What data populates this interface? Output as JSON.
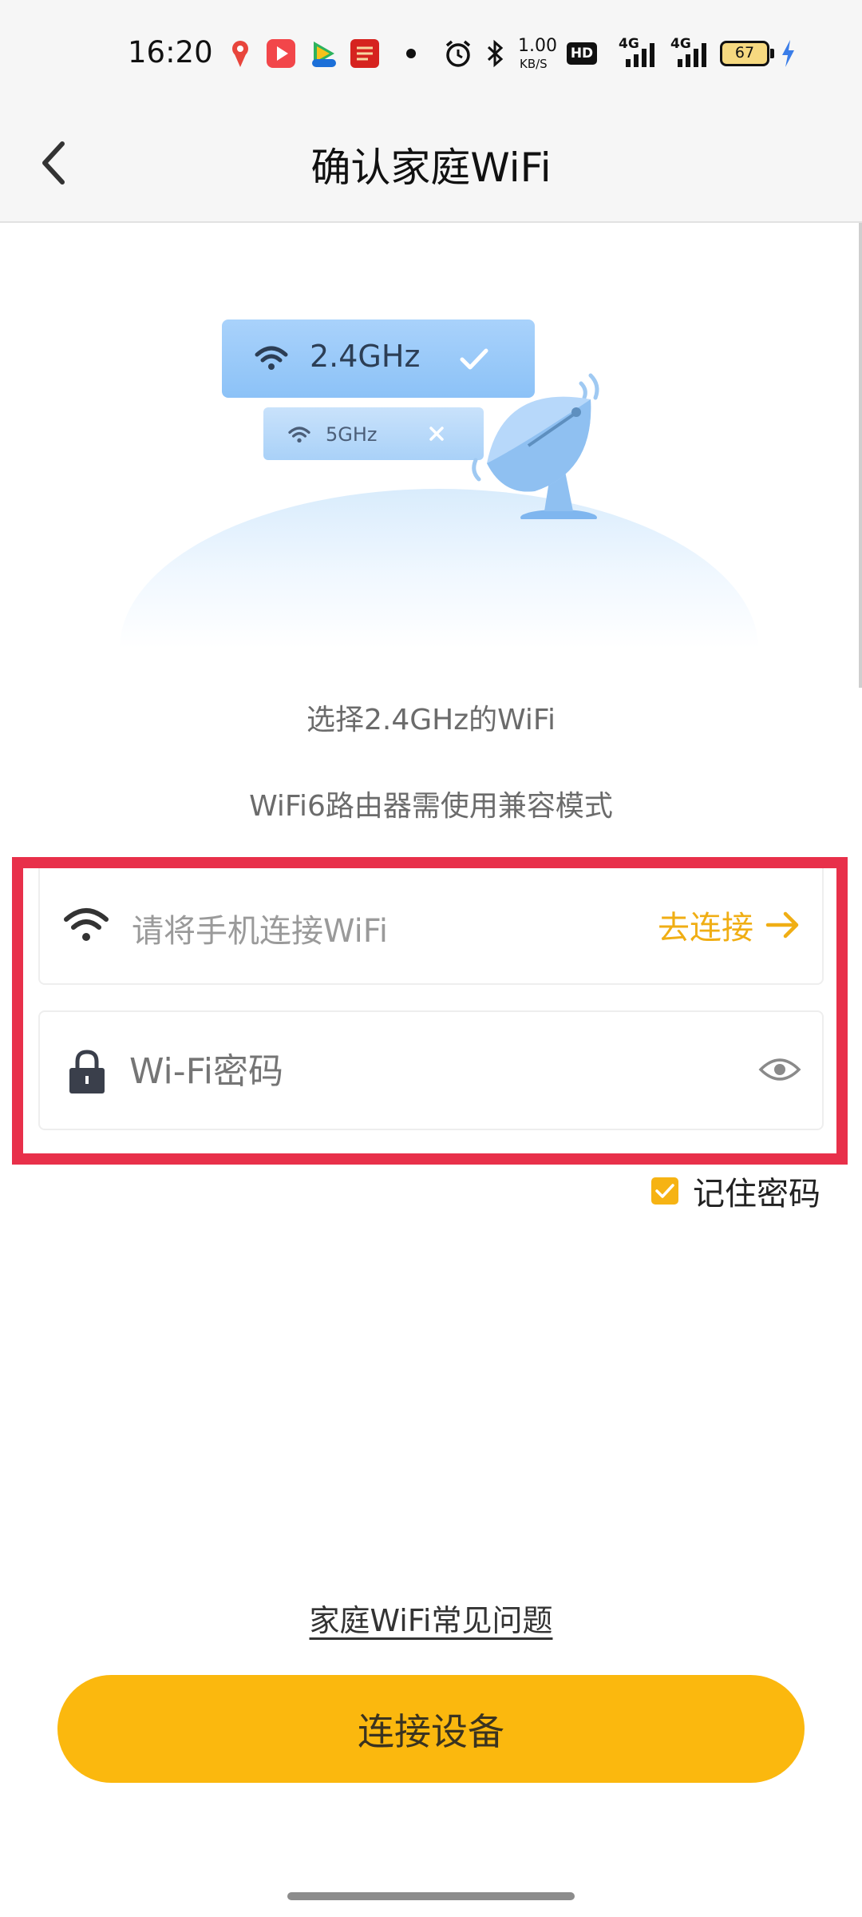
{
  "status_bar": {
    "time": "16:20",
    "net_speed_value": "1.00",
    "net_speed_unit": "KB/S",
    "hd_label": "HD",
    "sim1_label": "4G",
    "sim2_label": "4G",
    "battery": "67",
    "notification_icons": [
      "map-pin-icon",
      "video-app-icon",
      "tv-app-icon",
      "news-app-icon"
    ]
  },
  "header": {
    "title": "确认家庭WiFi"
  },
  "illustration": {
    "band_24": "2.4GHz",
    "band_5": "5GHz"
  },
  "hints": {
    "line1": "选择2.4GHz的WiFi",
    "line2": "WiFi6路由器需使用兼容模式"
  },
  "wifi_field": {
    "placeholder": "请将手机连接WiFi",
    "action": "去连接"
  },
  "password_field": {
    "placeholder": "Wi-Fi密码"
  },
  "remember": {
    "label": "记住密码",
    "checked": true
  },
  "footer": {
    "faq_link": "家庭WiFi常见问题",
    "connect_button": "连接设备"
  },
  "colors": {
    "accent": "#fbb80e",
    "highlight_frame": "#e8304a",
    "action_text": "#f0ae14"
  }
}
